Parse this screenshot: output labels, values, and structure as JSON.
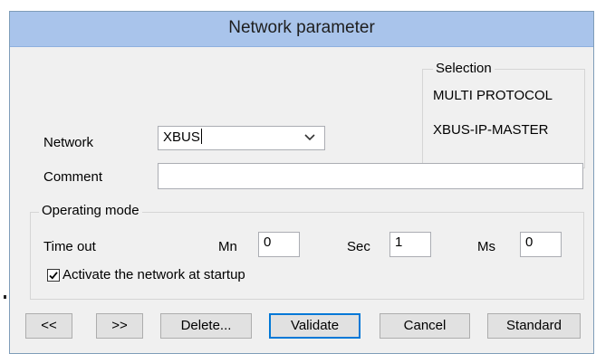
{
  "window": {
    "title": "Network parameter"
  },
  "selection": {
    "title": "Selection",
    "items": [
      "MULTI PROTOCOL",
      "XBUS-IP-MASTER"
    ]
  },
  "network": {
    "label": "Network",
    "value": "XBUS"
  },
  "comment": {
    "label": "Comment",
    "value": ""
  },
  "operating_mode": {
    "title": "Operating mode",
    "timeout_label": "Time out",
    "mn_label": "Mn",
    "mn_value": "0",
    "sec_label": "Sec",
    "sec_value": "1",
    "ms_label": "Ms",
    "ms_value": "0",
    "activate_label": "Activate the network at startup",
    "activate_checked": true
  },
  "buttons": {
    "prev": "<<",
    "next": ">>",
    "delete": "Delete...",
    "validate": "Validate",
    "cancel": "Cancel",
    "standard": "Standard"
  },
  "colors": {
    "titlebar": "#a9c4eb",
    "dialog_bg": "#f0f0f0",
    "default_button_border": "#0078d7"
  }
}
